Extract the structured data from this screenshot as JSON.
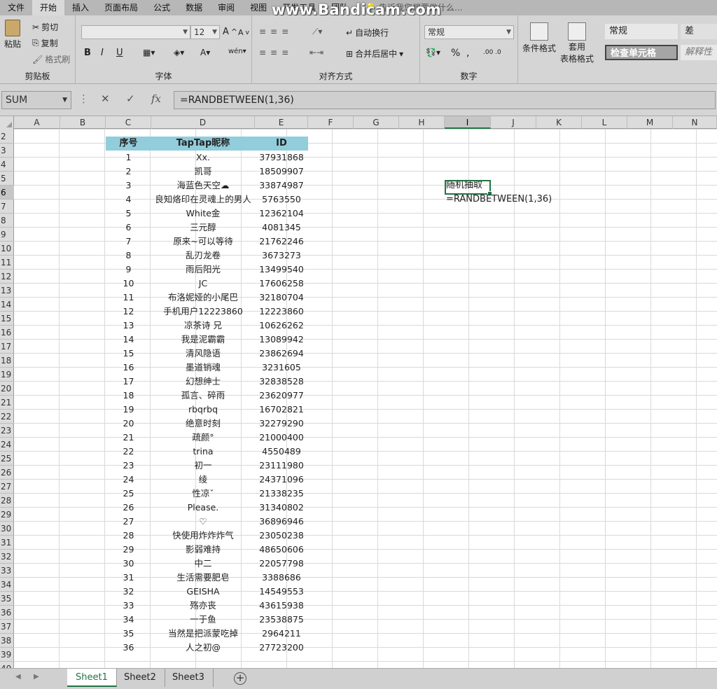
{
  "watermark": "www.Bandicam.com",
  "menu": {
    "tabs": [
      "文件",
      "开始",
      "插入",
      "页面布局",
      "公式",
      "数据",
      "审阅",
      "视图",
      "开发工具",
      "团队"
    ],
    "tell_me": "告诉我您想要做什么..."
  },
  "ribbon": {
    "clipboard": {
      "paste": "粘贴",
      "cut": "剪切",
      "copy": "复制",
      "format_painter": "格式刷",
      "label": "剪贴板"
    },
    "font": {
      "font_name": "",
      "font_size": "12",
      "bold": "B",
      "italic": "I",
      "underline": "U",
      "label": "字体"
    },
    "alignment": {
      "wrap": "自动换行",
      "merge": "合并后居中",
      "label": "对齐方式"
    },
    "number": {
      "format": "常规",
      "percent": "%",
      "comma": ",",
      "label": "数字"
    },
    "styles": {
      "conditional": "条件格式",
      "table_format_1": "套用",
      "table_format_2": "表格格式",
      "normal": "常规",
      "bad": "差",
      "check_cell": "检查单元格",
      "explanatory": "解释性"
    }
  },
  "formula_bar": {
    "name_box": "SUM",
    "cancel": "✕",
    "enter": "✓",
    "fx": "fx",
    "formula": "=RANDBETWEEN(1,36)"
  },
  "columns": [
    "A",
    "B",
    "C",
    "D",
    "E",
    "F",
    "G",
    "H",
    "I",
    "J",
    "K",
    "L",
    "M",
    "N"
  ],
  "selected_column": "I",
  "rows": [
    "2",
    "3",
    "4",
    "5",
    "6",
    "7",
    "8",
    "9",
    "10",
    "11",
    "12",
    "13",
    "14",
    "15",
    "16",
    "17",
    "18",
    "19",
    "20",
    "21",
    "22",
    "23",
    "24",
    "25",
    "26",
    "27",
    "28",
    "29",
    "30",
    "31",
    "32",
    "33",
    "34",
    "35",
    "36",
    "37",
    "38",
    "39",
    "40"
  ],
  "selected_row": "6",
  "table": {
    "headers": [
      "序号",
      "TapTap昵称",
      "ID"
    ],
    "rows": [
      [
        "1",
        "Xx.",
        "37931868"
      ],
      [
        "2",
        "凯哥",
        "18509907"
      ],
      [
        "3",
        "海蓝色天空☁",
        "33874987"
      ],
      [
        "4",
        "良知烙印在灵魂上的男人",
        "5763550"
      ],
      [
        "5",
        "White金",
        "12362104"
      ],
      [
        "6",
        "三元醇",
        "4081345"
      ],
      [
        "7",
        "原来~可以等待",
        "21762246"
      ],
      [
        "8",
        "乱刃龙卷",
        "3673273"
      ],
      [
        "9",
        "雨后阳光",
        "13499540"
      ],
      [
        "10",
        "JC",
        "17606258"
      ],
      [
        "11",
        "布洛妮娅的小尾巴",
        "32180704"
      ],
      [
        "12",
        "手机用户12223860",
        "12223860"
      ],
      [
        "13",
        "凉茶诗 兄",
        "10626262"
      ],
      [
        "14",
        "我是泥霸霸",
        "13089942"
      ],
      [
        "15",
        "清风隐语",
        "23862694"
      ],
      [
        "16",
        "墨道销魂",
        "3231605"
      ],
      [
        "17",
        "幻想绅士",
        "32838528"
      ],
      [
        "18",
        "孤言、碎雨",
        "23620977"
      ],
      [
        "19",
        "rbqrbq",
        "16702821"
      ],
      [
        "20",
        "绝意时刻",
        "32279290"
      ],
      [
        "21",
        "疏颜°",
        "21000400"
      ],
      [
        "22",
        "trina",
        "4550489"
      ],
      [
        "23",
        "初一",
        "23111980"
      ],
      [
        "24",
        "绫",
        "24371096"
      ],
      [
        "25",
        "性凉ˇ",
        "21338235"
      ],
      [
        "26",
        "Please.",
        "31340802"
      ],
      [
        "27",
        "♡",
        "36896946"
      ],
      [
        "28",
        "快使用炸炸炸气",
        "23050238"
      ],
      [
        "29",
        "影弱难持",
        "48650606"
      ],
      [
        "30",
        "中二",
        "22057798"
      ],
      [
        "31",
        "生活需要肥皂",
        "3388686"
      ],
      [
        "32",
        "GEISHA",
        "14549553"
      ],
      [
        "33",
        "殇亦丧",
        "43615938"
      ],
      [
        "34",
        "一于鱼",
        "23538875"
      ],
      [
        "35",
        "当然是把派蒙吃掉",
        "2964211"
      ],
      [
        "36",
        "人之初@",
        "27723200"
      ]
    ]
  },
  "side": {
    "label": "随机抽取",
    "editing": "=RANDBETWEEN(1,36)"
  },
  "sheets": [
    "Sheet1",
    "Sheet2",
    "Sheet3"
  ],
  "active_sheet": "Sheet1",
  "colors": {
    "accent": "#217346",
    "header_fill": "#92cddc"
  }
}
